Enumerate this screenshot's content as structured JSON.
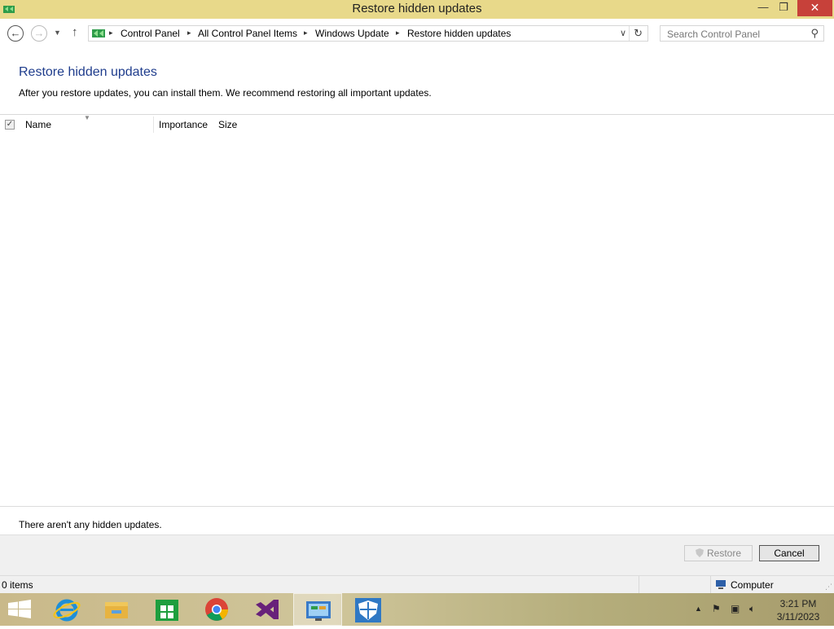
{
  "window": {
    "title": "Restore hidden updates",
    "minimize_glyph": "—",
    "maximize_glyph": "❐",
    "close_glyph": "✕"
  },
  "nav": {
    "back_glyph": "←",
    "forward_glyph": "→",
    "recent_glyph": "▼",
    "up_glyph": "↑",
    "breadcrumbs": [
      "Control Panel",
      "All Control Panel Items",
      "Windows Update",
      "Restore hidden updates"
    ],
    "separator_glyph": "▸",
    "dropdown_glyph": "∨",
    "refresh_glyph": "↻",
    "search_placeholder": "Search Control Panel",
    "search_glyph": "⚲"
  },
  "content": {
    "heading": "Restore hidden updates",
    "description": "After you restore updates, you can install them. We recommend restoring all important updates.",
    "columns": [
      "Name",
      "Importance",
      "Size"
    ],
    "empty_message": "There aren't any hidden updates."
  },
  "buttons": {
    "restore": "Restore",
    "cancel": "Cancel"
  },
  "status": {
    "items": "0 items",
    "location": "Computer"
  },
  "taskbar": {
    "apps": [
      "start-icon",
      "internet-explorer-icon",
      "file-explorer-icon",
      "store-icon",
      "chrome-icon",
      "visual-studio-icon",
      "control-panel-icon",
      "windows-defender-icon"
    ],
    "time": "3:21 PM",
    "date": "3/11/2023"
  },
  "colors": {
    "title_bar": "#e8d98a",
    "heading": "#1e3c8c",
    "close_button": "#c7413a"
  }
}
